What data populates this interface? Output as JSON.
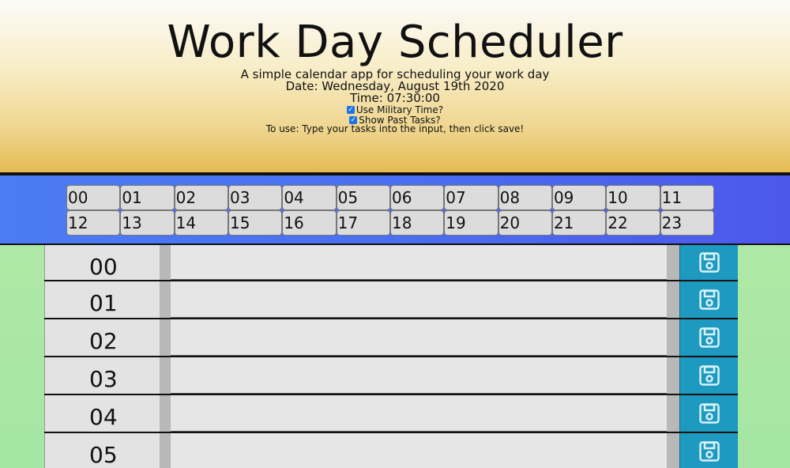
{
  "header": {
    "title": "Work Day Scheduler",
    "subtitle": "A simple calendar app for scheduling your work day",
    "date_line": "Date: Wednesday, August 19th 2020",
    "time_line": "Time: 07:30:00",
    "military_label": "Use Military Time?",
    "military_checked": true,
    "past_label": "Show Past Tasks?",
    "past_checked": true,
    "instructions": "To use: Type your tasks into the input, then click save!"
  },
  "hour_buttons": [
    "00",
    "01",
    "02",
    "03",
    "04",
    "05",
    "06",
    "07",
    "08",
    "09",
    "10",
    "11",
    "12",
    "13",
    "14",
    "15",
    "16",
    "17",
    "18",
    "19",
    "20",
    "21",
    "22",
    "23"
  ],
  "schedule": {
    "rows": [
      {
        "hour": "00",
        "task": ""
      },
      {
        "hour": "01",
        "task": ""
      },
      {
        "hour": "02",
        "task": ""
      },
      {
        "hour": "03",
        "task": ""
      },
      {
        "hour": "04",
        "task": ""
      },
      {
        "hour": "05",
        "task": ""
      }
    ],
    "save_icon": "floppy-disk-icon"
  },
  "colors": {
    "header_gradient_end": "#e4bb52",
    "nav_blue": "#4a6ff0",
    "save_teal": "#1e9ac0",
    "body_green": "#a5e6a4"
  }
}
